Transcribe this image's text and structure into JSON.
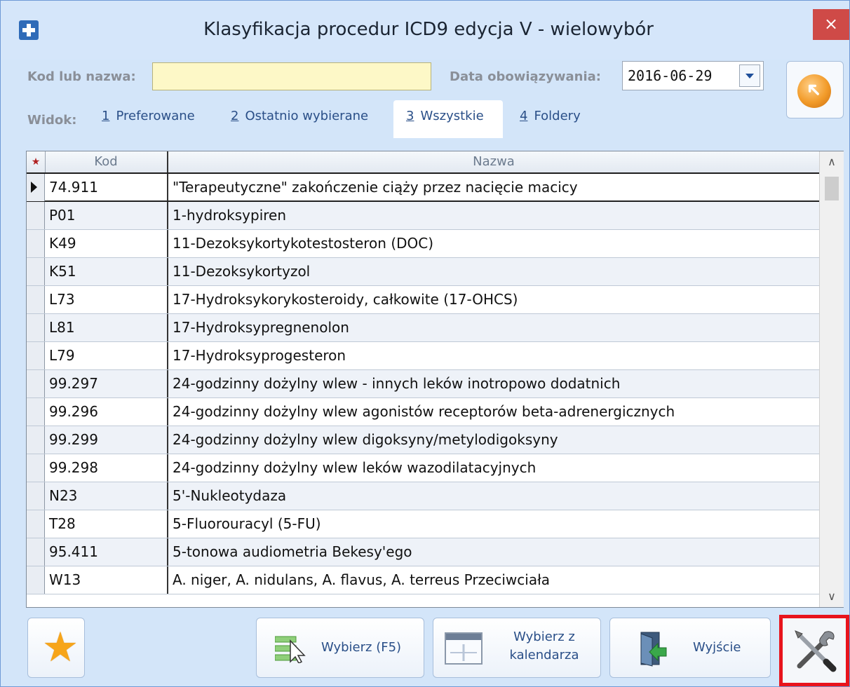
{
  "window": {
    "title": "Klasyfikacja procedur ICD9 edycja V - wielowybór",
    "close_glyph": "×"
  },
  "filters": {
    "kod_label": "Kod lub nazwa:",
    "kod_value": "",
    "data_label": "Data obowiązywania:",
    "data_value": "2016-06-29"
  },
  "view": {
    "label": "Widok:",
    "tabs": [
      {
        "num": "1",
        "label": "Preferowane",
        "active": false
      },
      {
        "num": "2",
        "label": "Ostatnio wybierane",
        "active": false
      },
      {
        "num": "3",
        "label": "Wszystkie",
        "active": true
      },
      {
        "num": "4",
        "label": "Foldery",
        "active": false
      }
    ]
  },
  "grid": {
    "columns": {
      "star": "★",
      "kod": "Kod",
      "nazwa": "Nazwa"
    },
    "rows": [
      {
        "kod": "74.911",
        "nazwa": "\"Terapeutyczne\" zakończenie ciąży przez nacięcie macicy"
      },
      {
        "kod": "P01",
        "nazwa": "1-hydroksypiren"
      },
      {
        "kod": "K49",
        "nazwa": "11-Dezoksykortykotestosteron (DOC)"
      },
      {
        "kod": "K51",
        "nazwa": "11-Dezoksykortyzol"
      },
      {
        "kod": "L73",
        "nazwa": "17-Hydroksykorykosteroidy, całkowite (17-OHCS)"
      },
      {
        "kod": "L81",
        "nazwa": "17-Hydroksypregnenolon"
      },
      {
        "kod": "L79",
        "nazwa": "17-Hydroksyprogesteron"
      },
      {
        "kod": "99.297",
        "nazwa": "24-godzinny dożylny wlew - innych leków inotropowo dodatnich"
      },
      {
        "kod": "99.296",
        "nazwa": "24-godzinny dożylny wlew agonistów receptorów beta-adrenergicznych"
      },
      {
        "kod": "99.299",
        "nazwa": "24-godzinny dożylny wlew digoksyny/metylodigoksyny"
      },
      {
        "kod": "99.298",
        "nazwa": "24-godzinny dożylny wlew leków wazodilatacyjnych"
      },
      {
        "kod": "N23",
        "nazwa": "5'-Nukleotydaza"
      },
      {
        "kod": "T28",
        "nazwa": "5-Fluorouracyl (5-FU)"
      },
      {
        "kod": "95.411",
        "nazwa": "5-tonowa audiometria Bekesy'ego"
      },
      {
        "kod": "W13",
        "nazwa": "A. niger, A. nidulans, A. flavus, A. terreus Przeciwciała"
      }
    ]
  },
  "buttons": {
    "wybierz": "Wybierz (F5)",
    "kalendarz_line1": "Wybierz z",
    "kalendarz_line2": "kalendarza",
    "wyjscie": "Wyjście"
  },
  "icons": {
    "app": "plus-icon",
    "favorites": "star-icon",
    "select": "list-cursor-icon",
    "calendar": "calendar-icon",
    "exit": "door-exit-icon",
    "tools": "tools-icon",
    "go": "orange-arrow-icon"
  },
  "colors": {
    "window_bg": "#d3e5f9",
    "input_bg": "#fdf8c7",
    "close_red": "#cf4a47",
    "highlight_red": "#e8141c",
    "link_blue": "#2a4f88"
  }
}
